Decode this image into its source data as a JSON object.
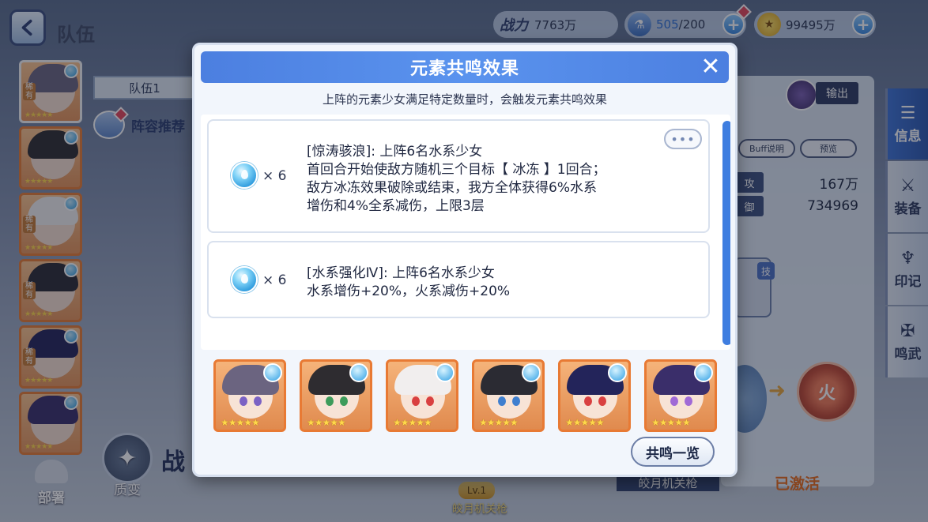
{
  "screen": {
    "title": "队伍",
    "back_icon": "back-arrow-icon"
  },
  "resources": {
    "power_label": "战力",
    "power_value": "7763万",
    "stamina_current": "505",
    "stamina_sep_max": "/200",
    "coins": "99495万"
  },
  "background": {
    "team_tab": "队伍1",
    "lineup_recommend": "阵容推荐",
    "deploy": "部署",
    "transform": "质变",
    "battle_text": "战",
    "role_tag": "输出",
    "buff_btn": "Buff说明",
    "preview_btn": "预览",
    "stat1_chip": "攻",
    "stat1_value": "167万",
    "stat2_chip": "御",
    "stat2_value": "734969",
    "skill_tag": "技",
    "weapon_name": "皎月机关枪",
    "weapon_level": "Lv.1",
    "activated": "已激活",
    "gear_b_glyph": "火",
    "rare_tag": "稀有",
    "side_tabs": [
      {
        "label": "信息",
        "icon": "info-icon"
      },
      {
        "label": "装备",
        "icon": "sword-icon"
      },
      {
        "label": "印记",
        "icon": "imprint-icon"
      },
      {
        "label": "鸣武",
        "icon": "resonance-weapon-icon"
      }
    ]
  },
  "modal": {
    "title": "元素共鸣效果",
    "close": "✕",
    "subtitle": "上阵的元素少女满足特定数量时，会触发元素共鸣效果",
    "effects": [
      {
        "element_icon": "water-drop-icon",
        "count": "× 6",
        "title": "[惊涛骇浪]: 上阵6名水系少女",
        "desc_lines": [
          "首回合开始使敌方随机三个目标【 冰冻 】1回合；",
          "敌方冰冻效果破除或结束，我方全体获得6%水系",
          "增伤和4%全系减伤，上限3层"
        ],
        "more": "•••"
      },
      {
        "element_icon": "water-drop-icon",
        "count": "× 6",
        "title": "[水系强化Ⅳ]: 上阵6名水系少女",
        "desc_lines": [
          "水系增伤+20%，火系减伤+20%"
        ]
      }
    ],
    "scroll_progress": 1.0,
    "girls": [
      {
        "hair": "#6b6480",
        "eyes": "#7b62c4",
        "bg": "#f5b37a"
      },
      {
        "hair": "#2e2c30",
        "eyes": "#3d9b5a",
        "bg": "#f5b37a"
      },
      {
        "hair": "#f1eeee",
        "eyes": "#d94040",
        "bg": "#f5b37a"
      },
      {
        "hair": "#2b2b33",
        "eyes": "#3f7fcf",
        "bg": "#f5b37a"
      },
      {
        "hair": "#23245a",
        "eyes": "#d94040",
        "bg": "#f5b37a"
      },
      {
        "hair": "#3a2e6a",
        "eyes": "#a06ad6",
        "bg": "#f5b37a"
      }
    ],
    "stars": "★★★★★",
    "resonance_list_btn": "共鸣一览"
  }
}
